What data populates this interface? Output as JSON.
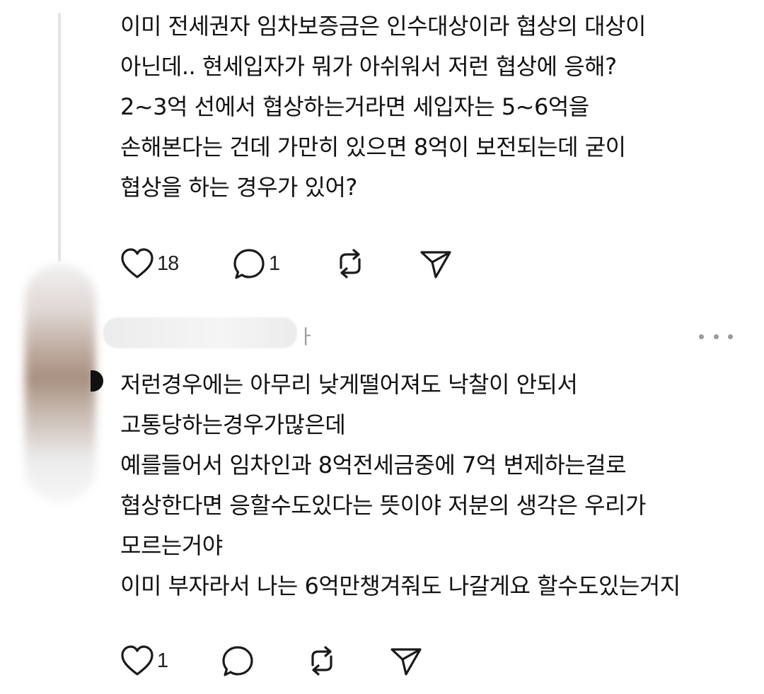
{
  "reply1": {
    "lines": [
      "이미 전세권자 임차보증금은 인수대상이라 협상의 대상이",
      "아닌데.. 현세입자가 뭐가 아쉬워서 저런 협상에 응해?",
      "2~3억 선에서 협상하는거라면 세입자는 5~6억을",
      "손해본다는 건데 가만히 있으면 8억이 보전되는데 굳이",
      "협상을 하는 경우가 있어?"
    ],
    "like_count": "18",
    "reply_count": "1"
  },
  "reply2": {
    "username_tail": "ㅏ",
    "lines": [
      "저런경우에는 아무리 낮게떨어져도 낙찰이 안되서",
      "고통당하는경우가많은데",
      "예를들어서 임차인과 8억전세금중에 7억 변제하는걸로",
      "협상한다면 응할수도있다는 뜻이야 저분의 생각은 우리가",
      "모르는거야",
      "이미 부자라서 나는 6억만챙겨줘도 나갈게요 할수도있는거지"
    ],
    "like_count": "1"
  },
  "icons": {
    "like": "heart-icon",
    "reply": "speech-bubble-icon",
    "repost": "repost-icon",
    "share": "send-icon",
    "more": "more-dots-icon"
  },
  "colors": {
    "text": "#111111",
    "icon_stroke": "#1a1a1a",
    "secondary": "#9a9a9a",
    "thread_line": "#e4e4e4"
  }
}
